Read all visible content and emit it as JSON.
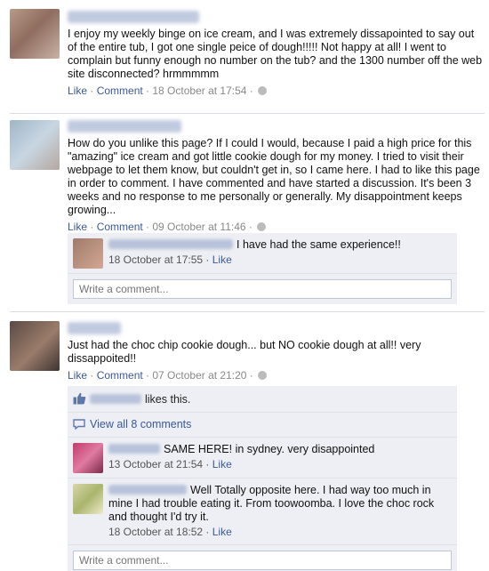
{
  "posts": [
    {
      "text": "I enjoy my weekly binge on ice cream, and I was extremely dissapointed to say out of the entire tub, I got one single peice of dough!!!!! Not happy at all! I went to complain but funny enough no number on the tub? and the 1300 number off the web site disconnected? hrmmmmm",
      "like": "Like",
      "comment": "Comment",
      "time": "18 October at 17:54"
    },
    {
      "text": "How do you unlike this page? If I could I would, because I paid a high price for this \"amazing\" ice cream and got little cookie dough for my money. I tried to visit their webpage to let them know, but couldn't get in, so I came here. I had to like this page in order to comment. I have commented and have started a discussion. It's been 3 weeks and no response to me personally or generally. My disappointment keeps growing...",
      "like": "Like",
      "comment": "Comment",
      "time": "09 October at 11:46",
      "replies": [
        {
          "text": "I have had the same experience!!",
          "time": "18 October at 17:55",
          "like": "Like"
        }
      ],
      "write_placeholder": "Write a comment..."
    },
    {
      "text": "Just had the choc chip cookie dough... but NO cookie dough at all!! very dissappoited!!",
      "like": "Like",
      "comment": "Comment",
      "time": "07 October at 21:20",
      "likes_text": "likes this.",
      "view_all": "View all 8 comments",
      "replies": [
        {
          "text": "SAME HERE! in sydney. very disappointed",
          "time": "13 October at 21:54",
          "like": "Like"
        },
        {
          "text": "Well Totally opposite here. I had way too much in mine I had trouble eating it. From toowoomba. I love the choc rock and thought I'd try it.",
          "time": "18 October at 18:52",
          "like": "Like"
        }
      ],
      "write_placeholder": "Write a comment..."
    }
  ],
  "colors": {
    "link": "#3b5998",
    "ufi_bg": "#edeff4",
    "meta": "#888888"
  },
  "icons": {
    "privacy": "globe-icon",
    "like": "thumbs-up-icon",
    "comments": "speech-bubble-icon"
  }
}
